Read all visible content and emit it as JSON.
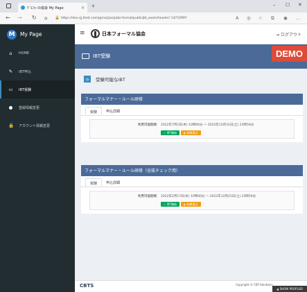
{
  "browser": {
    "tab_title": "ﾃﾞﾓﾌｫｰﾏﾙ協会 My Page",
    "tab_close": "×",
    "new_tab": "+",
    "window_controls": [
      "–",
      "☐",
      "✕"
    ],
    "url": "https://dev.cjj.itest.com/jp/ns/jaos/jabs-formal/publicjbt_exam/header/ 13/7/2997"
  },
  "app": {
    "name": "My Page",
    "logo_letter": "M",
    "org_name": "日本フォーマル協会",
    "logout": "ログアウト"
  },
  "sidebar": {
    "items": [
      {
        "icon": "home-icon",
        "glyph": "⌂",
        "label": "HOME",
        "active": false
      },
      {
        "icon": "pencil-icon",
        "glyph": "✎",
        "label": "IBT申込",
        "active": false
      },
      {
        "icon": "monitor-icon",
        "glyph": "▭",
        "label": "IBT受験",
        "active": true
      },
      {
        "icon": "user-icon",
        "glyph": "●",
        "label": "登録情報変更",
        "active": false
      },
      {
        "icon": "lock-icon",
        "glyph": "🔒",
        "label": "アカウント情報変更",
        "active": false
      }
    ]
  },
  "content": {
    "banner_title": "IBT受験",
    "demo_badge": "DEMO",
    "section_title": "受験可能なIBT",
    "cards": [
      {
        "title": "フォーマルマナー・ルール研修",
        "tabs": [
          "受験",
          "申込詳細"
        ],
        "period_label": "利用可能期間",
        "period_value": "2022年7月1日(木) 10時00分 ～ 2022年12月31日(土) 23時59分",
        "btn_primary": "IBT開始",
        "btn_secondary": "結果表示"
      },
      {
        "title": "フォーマルマナー・ルール研修（全設チェック用）",
        "tabs": [
          "受験",
          "申込詳細"
        ],
        "period_label": "利用可能期間",
        "period_value": "2022年2月17日(木) 10時00分 ～ 2022年12月21日(土) 23時59分",
        "btn_primary": "IBT開始",
        "btn_secondary": "結果表示"
      }
    ]
  },
  "footer": {
    "brand": "CBTS",
    "copyright": "Copyright © CBT-Solutions",
    "show_profiler": "SHOW PROFILER"
  },
  "colors": {
    "sidebar_bg": "#222d32",
    "banner": "#4b6a98",
    "demo": "#dd4b39",
    "green": "#00a65a",
    "orange": "#f39c12"
  }
}
